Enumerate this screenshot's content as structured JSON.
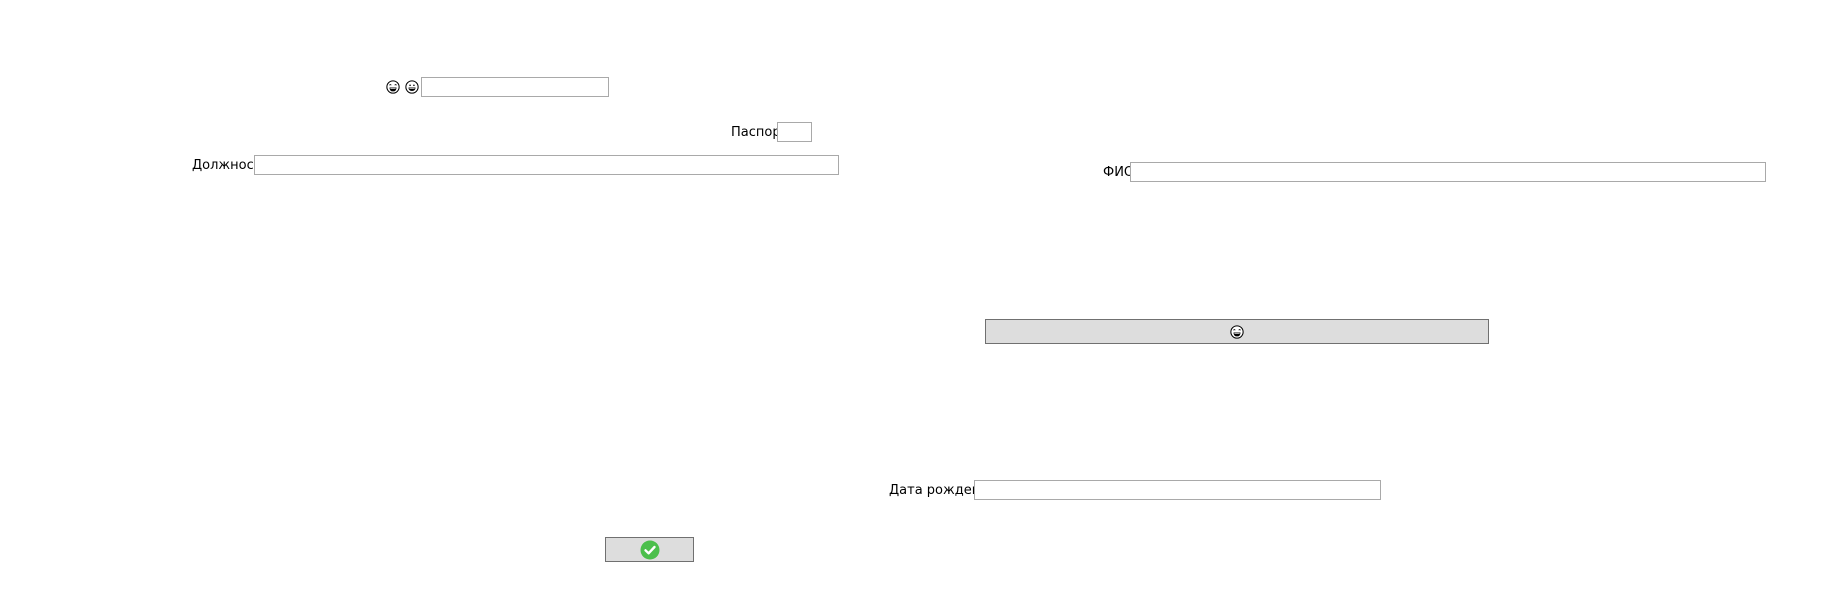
{
  "form": {
    "top_search": {
      "value": "",
      "placeholder": ""
    },
    "icons": {
      "first": "laughing-face-icon",
      "second": "grinning-face-icon",
      "button_face": "laughing-face-icon",
      "confirm": "check-circle-icon"
    },
    "passport": {
      "label": "Паспорт",
      "value": ""
    },
    "position": {
      "label": "Должность",
      "value": ""
    },
    "fio": {
      "label": "ФИО",
      "value": ""
    },
    "birth_date": {
      "label": "Дата рождения",
      "value": ""
    }
  },
  "colors": {
    "button_bg": "#dddddd",
    "check_green": "#4cbf4c",
    "field_border": "#a9a9a9"
  }
}
